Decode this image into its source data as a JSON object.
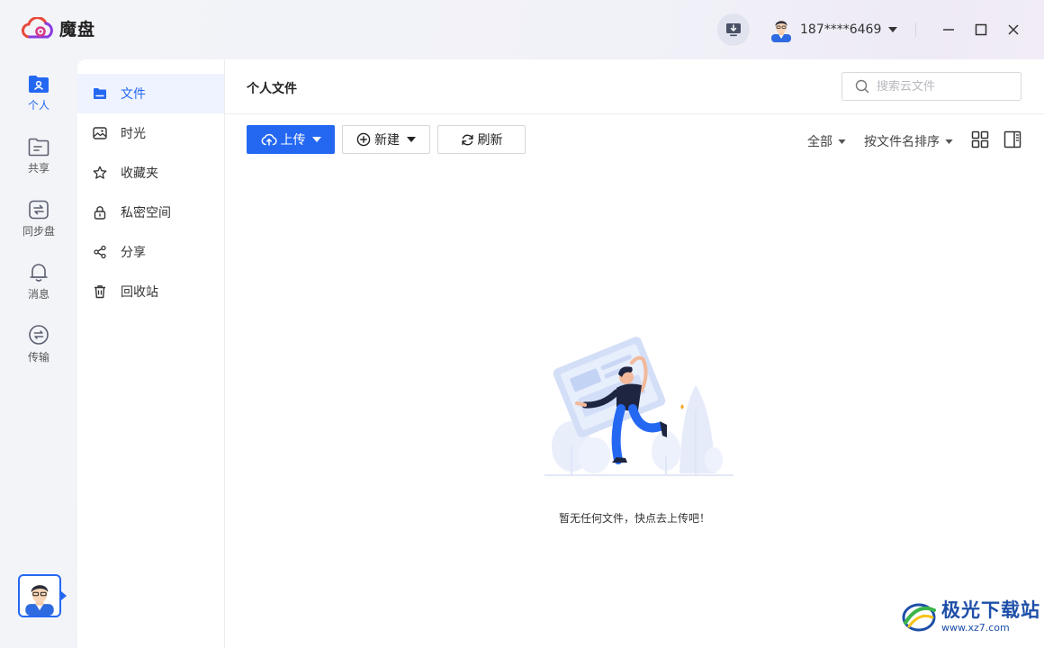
{
  "app": {
    "name": "魔盘"
  },
  "colors": {
    "accent": "#2468f2",
    "text": "#222222",
    "muted": "#555555",
    "border": "#d6d6dc"
  },
  "titlebar": {
    "download_icon": "download-tray-icon",
    "user": {
      "phone": "187****6469",
      "avatar_icon": "user-avatar-icon"
    },
    "window_controls": [
      "minimize-icon",
      "maximize-icon",
      "close-icon"
    ]
  },
  "rail": {
    "items": [
      {
        "label": "个人",
        "icon": "person-icon",
        "active": true
      },
      {
        "label": "共享",
        "icon": "shared-folder-icon",
        "active": false
      },
      {
        "label": "同步盘",
        "icon": "sync-icon",
        "active": false
      },
      {
        "label": "消息",
        "icon": "bell-icon",
        "active": false
      },
      {
        "label": "传输",
        "icon": "transfer-icon",
        "active": false
      }
    ]
  },
  "subnav": {
    "items": [
      {
        "label": "文件",
        "icon": "folder-icon",
        "active": true
      },
      {
        "label": "时光",
        "icon": "photo-icon",
        "active": false
      },
      {
        "label": "收藏夹",
        "icon": "star-icon",
        "active": false
      },
      {
        "label": "私密空间",
        "icon": "lock-icon",
        "active": false
      },
      {
        "label": "分享",
        "icon": "share-icon",
        "active": false
      },
      {
        "label": "回收站",
        "icon": "trash-icon",
        "active": false
      }
    ]
  },
  "main": {
    "title": "个人文件",
    "search": {
      "placeholder": "搜索云文件",
      "value": ""
    },
    "toolbar": {
      "upload_label": "上传",
      "new_label": "新建",
      "refresh_label": "刷新",
      "filter_label": "全部",
      "sort_label": "按文件名排序",
      "view_icons": [
        "grid-view-icon",
        "detail-panel-icon"
      ]
    },
    "empty": {
      "text": "暂无任何文件，快点去上传吧！"
    }
  },
  "watermark": {
    "name": "极光下载站",
    "url": "www.xz7.com"
  }
}
